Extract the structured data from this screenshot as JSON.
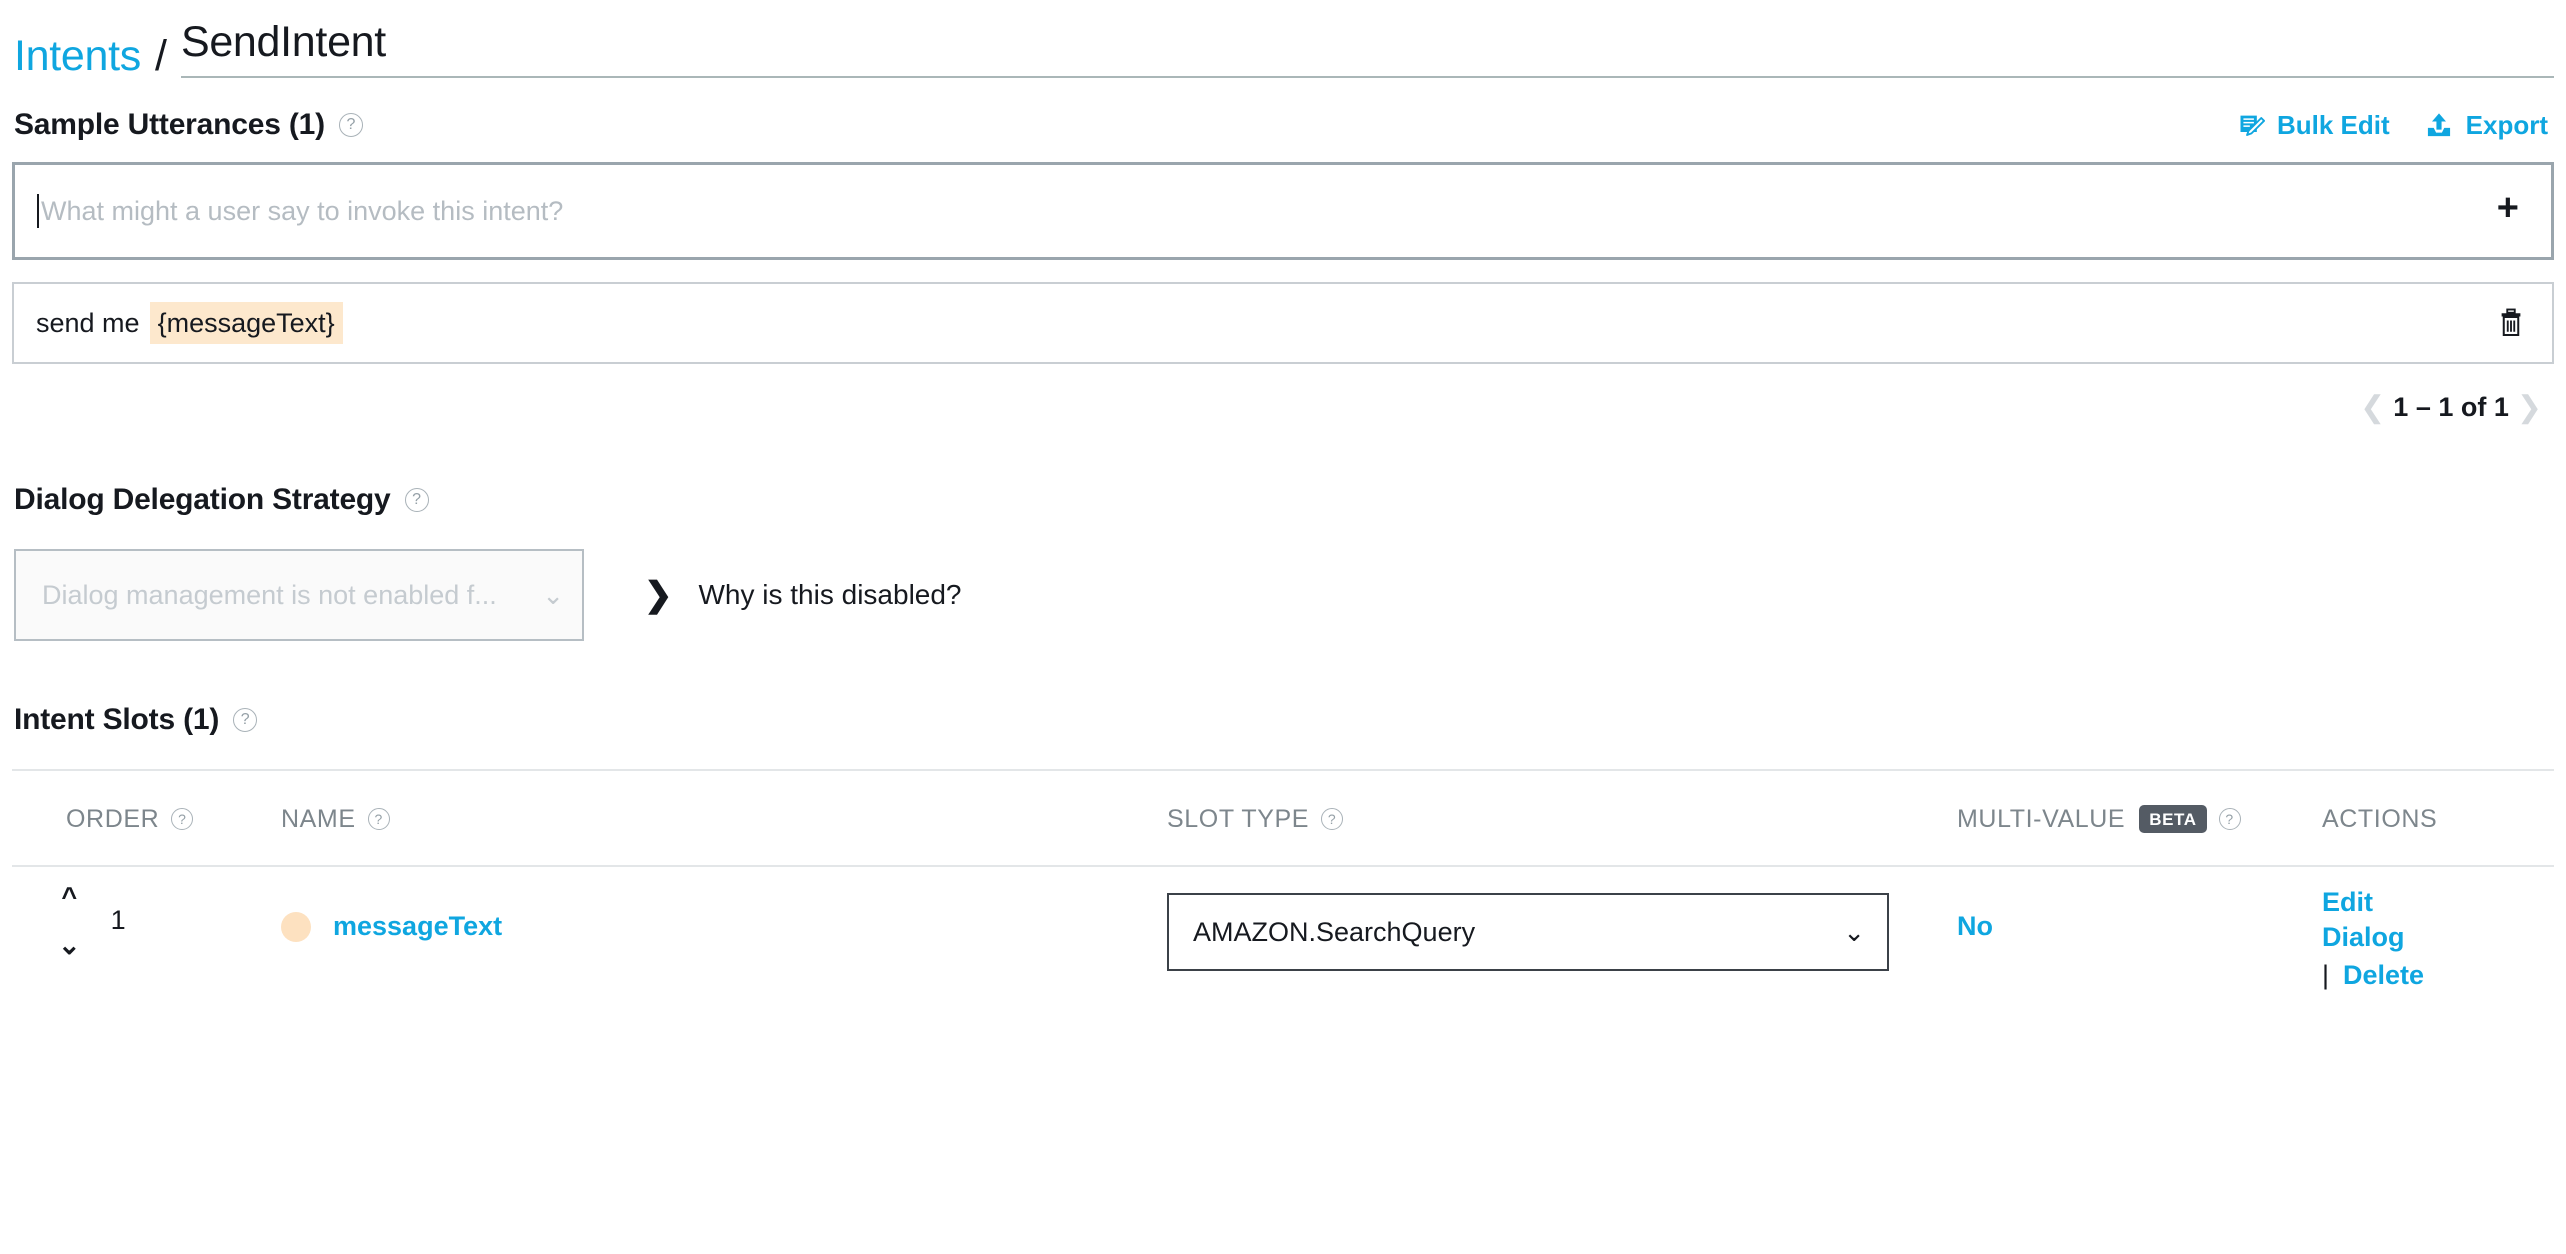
{
  "breadcrumb": {
    "parent": "Intents",
    "separator": "/",
    "current": "SendIntent"
  },
  "sample_utterances": {
    "title": "Sample Utterances (1)",
    "help_icon": "question-circle-icon",
    "bulk_edit_label": "Bulk Edit",
    "bulk_edit_icon": "bulk-edit-icon",
    "export_label": "Export",
    "export_icon": "export-upload-icon",
    "input": {
      "value": "",
      "placeholder": "What might a user say to invoke this intent?",
      "add_icon": "plus-icon"
    },
    "rows": [
      {
        "prefix": "send me",
        "slot": "{messageText}",
        "delete_icon": "trash-icon"
      }
    ],
    "pagination": {
      "prev_icon": "chevron-left-icon",
      "label": "1 – 1 of 1",
      "next_icon": "chevron-right-icon"
    }
  },
  "dialog_delegation": {
    "title": "Dialog Delegation Strategy",
    "help_icon": "question-circle-icon",
    "select_value": "Dialog management is not enabled f...",
    "select_chevron_icon": "chevron-down-icon",
    "why_disabled_label": "Why is this disabled?",
    "why_disabled_icon": "chevron-right-icon"
  },
  "intent_slots": {
    "title": "Intent Slots (1)",
    "help_icon": "question-circle-icon",
    "columns": [
      {
        "label": "ORDER",
        "help_icon": "question-circle-icon"
      },
      {
        "label": "NAME",
        "help_icon": "question-circle-icon"
      },
      {
        "label": "SLOT TYPE",
        "help_icon": "question-circle-icon"
      },
      {
        "label": "MULTI-VALUE",
        "badge": "BETA",
        "help_icon": "question-circle-icon"
      },
      {
        "label": "ACTIONS"
      }
    ],
    "rows": [
      {
        "order": "1",
        "move_up_icon": "chevron-up-icon",
        "move_down_icon": "chevron-down-icon",
        "dot_icon": "slot-color-dot",
        "name": "messageText",
        "slot_type": "AMAZON.SearchQuery",
        "slot_type_chevron_icon": "chevron-down-icon",
        "multi_value": "No",
        "action_edit_dialog": "Edit Dialog",
        "action_separator": "|",
        "action_delete": "Delete"
      }
    ]
  },
  "colors": {
    "link": "#0fa6e0",
    "text": "#16191f",
    "muted": "#7d868c",
    "slot_highlight": "#fde8cd",
    "slot_dot": "#fde1c0",
    "badge_bg": "#545b64"
  }
}
